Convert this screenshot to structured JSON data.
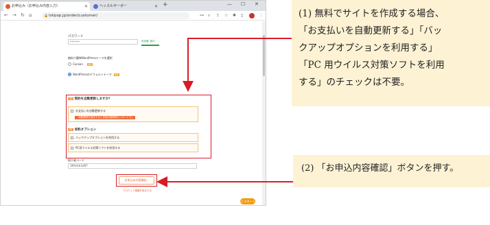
{
  "browser": {
    "tabs": [
      {
        "label": "お申込み（お申込み内容入力）",
        "favicon_color": "#e4572e"
      },
      {
        "label": "ヘッスルサーポー",
        "favicon_color": "#5a6fd6"
      }
    ],
    "url": "lolipop.jp/order/customer/",
    "new_tab": "+",
    "window_controls": {
      "minimize": "—",
      "maximize": "☐",
      "close": "✕"
    }
  },
  "page": {
    "password_label": "パスワード",
    "password_value": "••••••",
    "strength_text": "安全度: 強中",
    "wordpress_label": "無料で簡単WordPressテーマを選択",
    "radio_options": [
      {
        "label": "Cocoon",
        "badge": "推奨"
      },
      {
        "label": "WordPressのデフォルトテーマ",
        "badge": "推奨"
      }
    ],
    "section1_num": "(1)",
    "section1_title": "契約を自動更新しますか？",
    "auto_renew_label": "お支払いを自動更新する",
    "auto_renew_note": "「自動更新を設定すると次回の更新時もリロードで」",
    "section2_num": "(2)",
    "section2_title": "有料オプション",
    "backup_label": "バックアップオプションを利用する",
    "antivirus_label": "PC用ウイルス対策ソフトを利用する",
    "promo_label": "紹介者コード",
    "promo_value": "3N9z4b1bNT",
    "confirm_button": "お申込み内容確認 ›",
    "below_button": "アカウント情報を修正する",
    "start_button": "ⓢ スタート"
  },
  "callouts": {
    "first": [
      "(1) 無料でサイトを作成する場合、",
      "「お支払いを自動更新する」「バッ",
      "クアップオプションを利用する」",
      "「PC 用ウイルス対策ソフトを利用",
      "する」のチェックは不要。"
    ],
    "second": "(2) 「お申込内容確認」ボタンを押す。"
  },
  "colors": {
    "arrow_red": "#d81b26",
    "callout_bg": "#fdf2d4",
    "accent_orange": "#ef8a2e"
  }
}
